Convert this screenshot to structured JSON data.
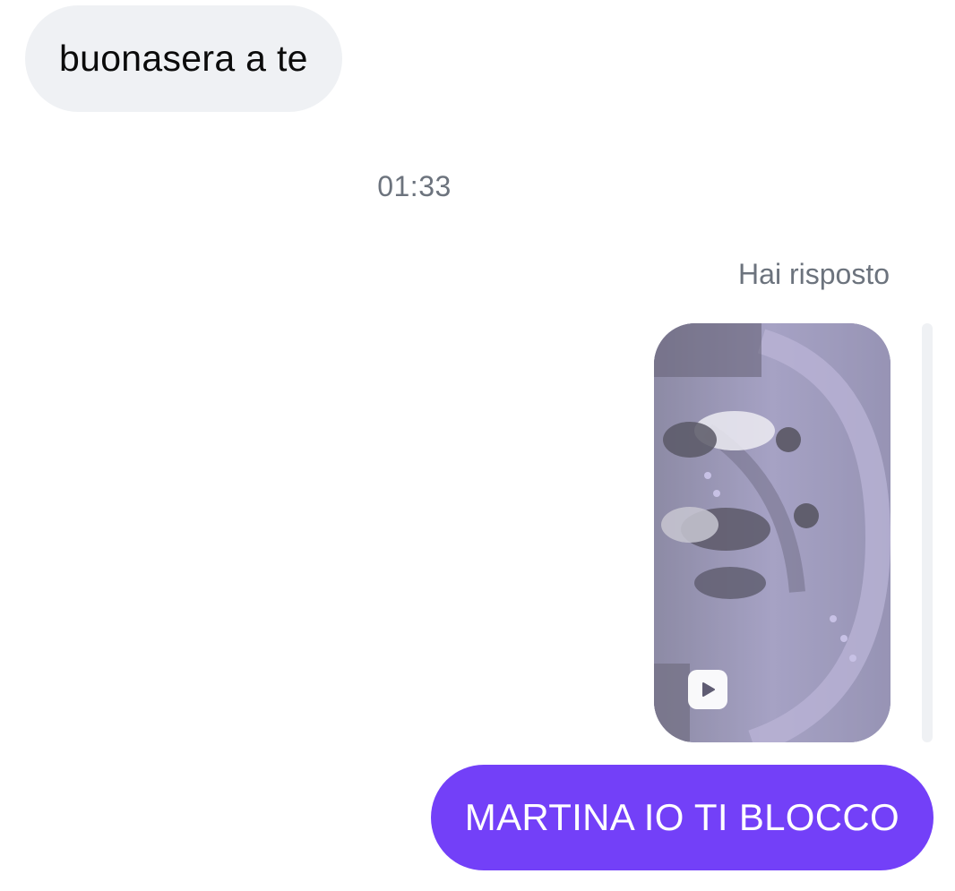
{
  "conversation": {
    "messages": [
      {
        "direction": "incoming",
        "text": "buonasera a te"
      },
      {
        "direction": "outgoing",
        "text": "MARTINA IO TI BLOCCO"
      }
    ],
    "timestamp": "01:33",
    "reply_label": "Hai risposto",
    "media": {
      "type": "video",
      "icon": "play-icon"
    }
  },
  "colors": {
    "incoming_bubble": "#eff1f4",
    "outgoing_bubble": "#7340f8",
    "meta_text": "#6c737d"
  }
}
